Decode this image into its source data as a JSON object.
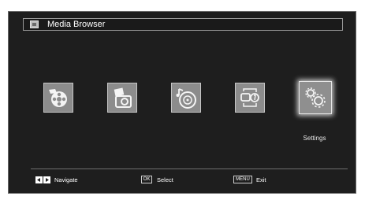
{
  "header": {
    "title": "Media Browser",
    "icon": "media-browser-icon"
  },
  "tiles": [
    {
      "name": "video",
      "icon": "film-reel-icon"
    },
    {
      "name": "photo",
      "icon": "camera-icon"
    },
    {
      "name": "music",
      "icon": "music-disc-icon"
    },
    {
      "name": "auto-play",
      "icon": "auto-play-icon"
    },
    {
      "name": "settings",
      "icon": "gears-icon",
      "selected": true
    }
  ],
  "selected_caption": "Settings",
  "footer": {
    "navigate_label": "Navigate",
    "ok_key": "OK",
    "select_label": "Select",
    "menu_key": "MENU",
    "exit_label": "Exit"
  },
  "colors": {
    "background": "#1e1e1e",
    "tile": "#8c8c8c",
    "text": "#ffffff"
  }
}
